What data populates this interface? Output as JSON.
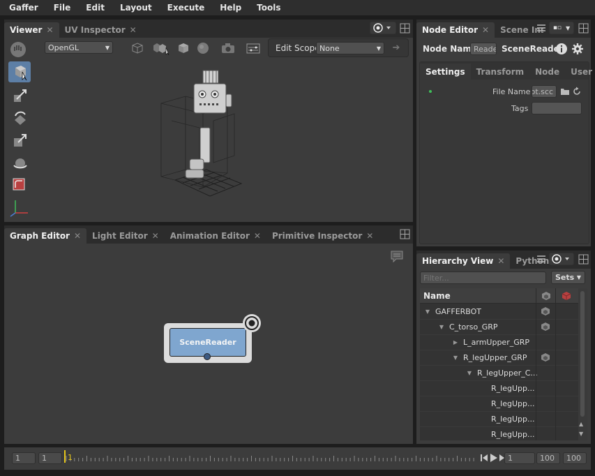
{
  "menu": [
    "Gaffer",
    "File",
    "Edit",
    "Layout",
    "Execute",
    "Help",
    "Tools"
  ],
  "viewer": {
    "tabs": [
      "Viewer",
      "UV Inspector"
    ],
    "renderer": "OpenGL",
    "edit_scope_label": "Edit Scope",
    "edit_scope_value": "None"
  },
  "node_editor": {
    "tabs": [
      "Node Editor",
      "Scene Inspe"
    ],
    "node_name_label": "Node Name",
    "node_name_value": "Reader",
    "node_type": "SceneReader",
    "subtabs": [
      "Settings",
      "Transform",
      "Node",
      "User"
    ],
    "file_name_label": "File Name",
    "file_name_value": "bot.scc",
    "tags_label": "Tags",
    "tags_value": ""
  },
  "graph": {
    "tabs": [
      "Graph Editor",
      "Light Editor",
      "Animation Editor",
      "Primitive Inspector"
    ],
    "node_label": "SceneReader"
  },
  "hierarchy": {
    "tabs": [
      "Hierarchy View",
      "Python"
    ],
    "filter_placeholder": "Filter...",
    "sets_label": "Sets",
    "column_name": "Name",
    "rows": [
      {
        "label": "GAFFERBOT",
        "chevron": "▼"
      },
      {
        "label": "C_torso_GRP",
        "chevron": "▼"
      },
      {
        "label": "L_armUpper_GRP",
        "chevron": "▶"
      },
      {
        "label": "R_legUpper_GRP",
        "chevron": "▼"
      },
      {
        "label": "R_legUpper_C...",
        "chevron": "▼"
      },
      {
        "label": "R_legUpp...",
        "chevron": ""
      },
      {
        "label": "R_legUpp...",
        "chevron": ""
      },
      {
        "label": "R_legUpp...",
        "chevron": ""
      },
      {
        "label": "R_legUpp...",
        "chevron": ""
      }
    ]
  },
  "timeline": {
    "start_frame": "1",
    "current_start": "1",
    "playhead": "1",
    "current_frame": "1",
    "end_current": "100",
    "end_frame": "100"
  },
  "colors": {
    "panel_bg": "#3c3c3c",
    "node_fill": "#7fa6cf",
    "playhead": "#e6c619",
    "status_dot": "#3fbf5a"
  }
}
